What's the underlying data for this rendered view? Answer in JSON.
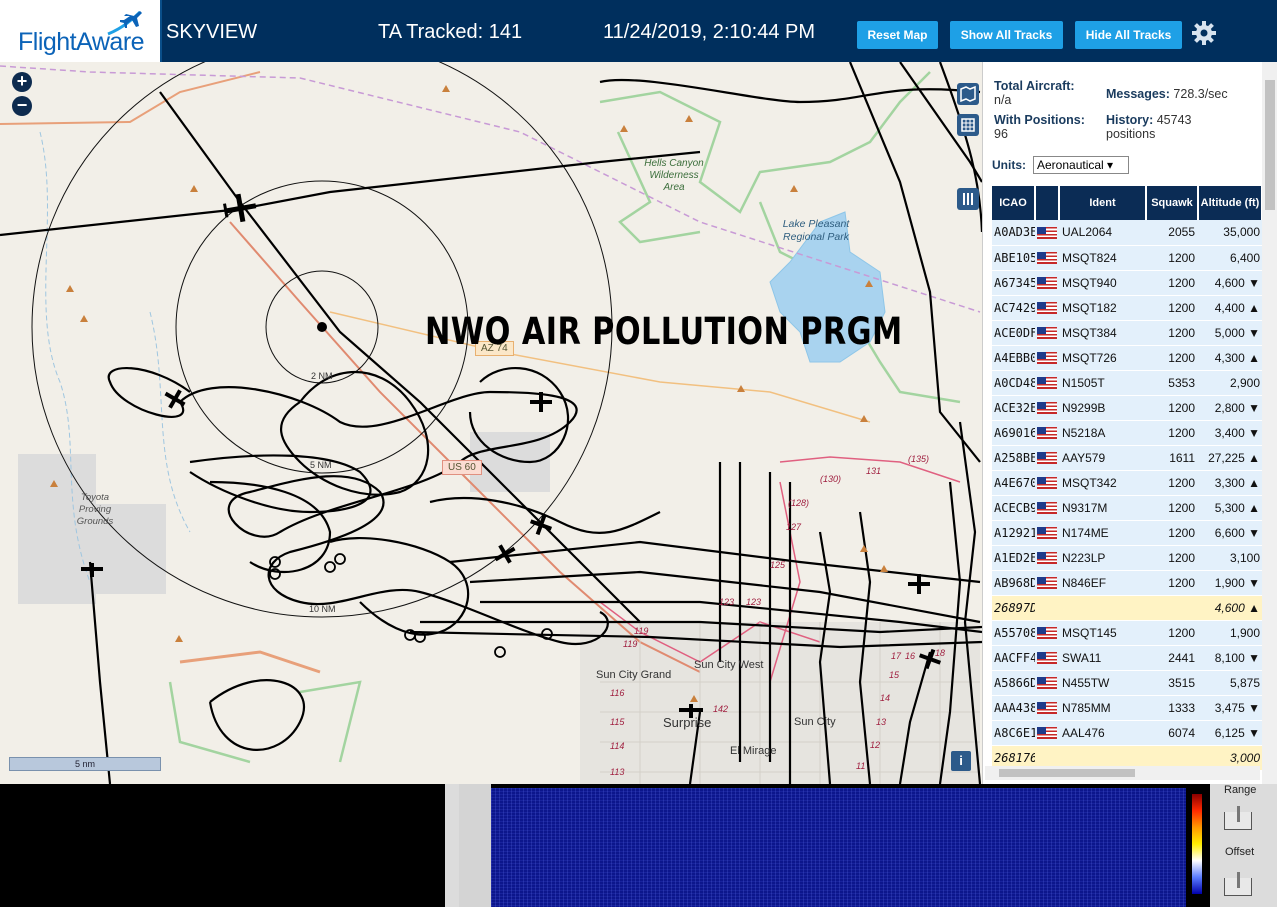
{
  "header": {
    "logo_text": "FlightAware",
    "title": "SKYVIEW",
    "tracked": "TA Tracked: 141",
    "datetime": "11/24/2019, 2:10:44 PM",
    "buttons": {
      "reset": "Reset Map",
      "show_all": "Show All Tracks",
      "hide_all": "Hide All Tracks"
    },
    "settings_icon": "gear-icon",
    "accent": "#1ea0e6",
    "bar_color": "#002f5d"
  },
  "map": {
    "overlay_text": "NWO AIR POLLUTION PRGM",
    "scale_label": "5 nm",
    "zoom_in": "+",
    "zoom_out": "−",
    "info": "i",
    "range_rings": [
      "2 NM",
      "5 NM",
      "10 NM"
    ],
    "labels": {
      "hells_canyon": "Hells Canyon Wilderness Area",
      "lake_pleasant": "Lake Pleasant Regional Park",
      "toyota": "Toyota Proving Grounds",
      "az74": "AZ 74",
      "us60": "US 60",
      "sun_city_grand": "Sun City Grand",
      "sun_city_west": "Sun City West",
      "surprise": "Surprise",
      "sun_city": "Sun City",
      "el_mirage": "El Mirage",
      "road_numbers": [
        "131",
        "(130)",
        "(135)",
        "(128)",
        "127",
        "125",
        "123",
        "123",
        "119",
        "119",
        "116",
        "115",
        "114",
        "113",
        "17",
        "16",
        "15",
        "14",
        "13",
        "12",
        "11",
        "142",
        "18"
      ]
    }
  },
  "panel": {
    "total_label": "Total Aircraft:",
    "total_value": "n/a",
    "positions_label": "With Positions:",
    "positions_value": "96",
    "messages_label": "Messages:",
    "messages_value": "728.3/sec",
    "history_label": "History:",
    "history_value": "45743",
    "history_unit": "positions",
    "units_label": "Units:",
    "units_value": "Aeronautical ▾",
    "columns": [
      "ICAO",
      "",
      "Ident",
      "Squawk",
      "Altitude (ft)"
    ],
    "rows": [
      {
        "icao": "A0AD3E",
        "flag": true,
        "ident": "UAL2064",
        "squawk": "2055",
        "alt": "35,000",
        "yellow": false
      },
      {
        "icao": "ABE105",
        "flag": true,
        "ident": "MSQT824",
        "squawk": "1200",
        "alt": "6,400",
        "yellow": false
      },
      {
        "icao": "A67345",
        "flag": true,
        "ident": "MSQT940",
        "squawk": "1200",
        "alt": "4,600 ▼",
        "yellow": false
      },
      {
        "icao": "AC7429",
        "flag": true,
        "ident": "MSQT182",
        "squawk": "1200",
        "alt": "4,400 ▲",
        "yellow": false
      },
      {
        "icao": "ACE0DF",
        "flag": true,
        "ident": "MSQT384",
        "squawk": "1200",
        "alt": "5,000 ▼",
        "yellow": false
      },
      {
        "icao": "A4EBB0",
        "flag": true,
        "ident": "MSQT726",
        "squawk": "1200",
        "alt": "4,300 ▲",
        "yellow": false
      },
      {
        "icao": "A0CD48",
        "flag": true,
        "ident": "N1505T",
        "squawk": "5353",
        "alt": "2,900",
        "yellow": false
      },
      {
        "icao": "ACE32E",
        "flag": true,
        "ident": "N9299B",
        "squawk": "1200",
        "alt": "2,800 ▼",
        "yellow": false
      },
      {
        "icao": "A69016",
        "flag": true,
        "ident": "N5218A",
        "squawk": "1200",
        "alt": "3,400 ▼",
        "yellow": false
      },
      {
        "icao": "A258BE",
        "flag": true,
        "ident": "AAY579",
        "squawk": "1611",
        "alt": "27,225 ▲",
        "yellow": false
      },
      {
        "icao": "A4E670",
        "flag": true,
        "ident": "MSQT342",
        "squawk": "1200",
        "alt": "3,300 ▲",
        "yellow": false
      },
      {
        "icao": "ACECB9",
        "flag": true,
        "ident": "N9317M",
        "squawk": "1200",
        "alt": "5,300 ▲",
        "yellow": false
      },
      {
        "icao": "A12921",
        "flag": true,
        "ident": "N174ME",
        "squawk": "1200",
        "alt": "6,600 ▼",
        "yellow": false
      },
      {
        "icao": "A1ED2E",
        "flag": true,
        "ident": "N223LP",
        "squawk": "1200",
        "alt": "3,100",
        "yellow": false
      },
      {
        "icao": "AB968D",
        "flag": true,
        "ident": "N846EF",
        "squawk": "1200",
        "alt": "1,900 ▼",
        "yellow": false
      },
      {
        "icao": "26897D",
        "flag": false,
        "ident": "",
        "squawk": "",
        "alt": "4,600 ▲",
        "yellow": true
      },
      {
        "icao": "A55708",
        "flag": true,
        "ident": "MSQT145",
        "squawk": "1200",
        "alt": "1,900",
        "yellow": false
      },
      {
        "icao": "AACFF4",
        "flag": true,
        "ident": "SWA11",
        "squawk": "2441",
        "alt": "8,100 ▼",
        "yellow": false
      },
      {
        "icao": "A5866D",
        "flag": true,
        "ident": "N455TW",
        "squawk": "3515",
        "alt": "5,875",
        "yellow": false
      },
      {
        "icao": "AAA438",
        "flag": true,
        "ident": "N785MM",
        "squawk": "1333",
        "alt": "3,475 ▼",
        "yellow": false
      },
      {
        "icao": "A8C6E1",
        "flag": true,
        "ident": "AAL476",
        "squawk": "6074",
        "alt": "6,125 ▼",
        "yellow": false
      },
      {
        "icao": "268176",
        "flag": false,
        "ident": "",
        "squawk": "",
        "alt": "3,000",
        "yellow": true
      }
    ]
  },
  "spectrum": {
    "range_label": "Range",
    "offset_label": "Offset"
  }
}
